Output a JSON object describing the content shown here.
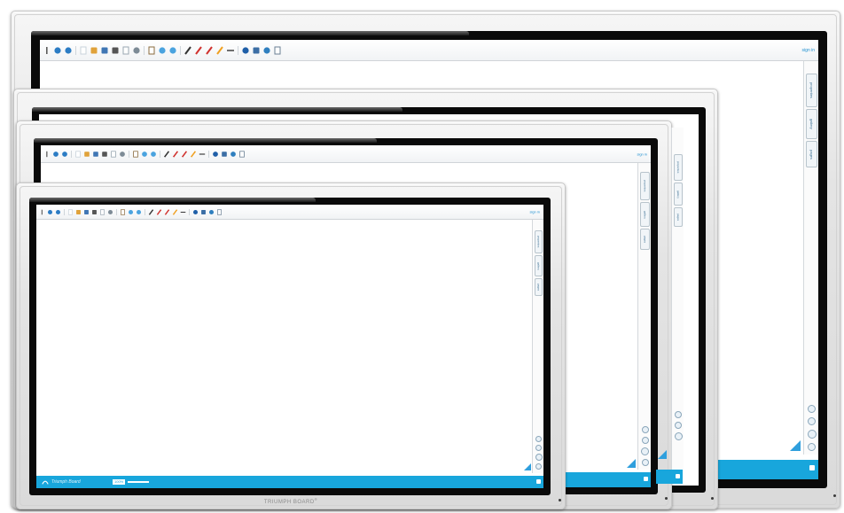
{
  "boards": [
    {
      "name": "board-xl",
      "signin": "sign in",
      "side_tabs": [
        "properties",
        "gallery",
        "pages"
      ]
    },
    {
      "name": "board-lg",
      "signin": "sign in",
      "side_tabs": [
        "properties",
        "gallery",
        "pages"
      ]
    },
    {
      "name": "board-md",
      "signin": "sign in",
      "side_tabs": [
        "properties",
        "gallery",
        "pages"
      ]
    },
    {
      "name": "board-sm",
      "signin": "sign in",
      "side_tabs": [
        "properties",
        "gallery",
        "pages"
      ]
    }
  ],
  "toolbar_icons": [
    "menu-icon",
    "undo-icon",
    "redo-icon",
    "new-page-icon",
    "open-folder-icon",
    "save-icon",
    "print-icon",
    "screen-shade-icon",
    "magnifier-icon",
    "clipboard-icon",
    "previous-page-icon",
    "next-page-icon",
    "pen-icon",
    "red-pen-icon",
    "highlighter-icon",
    "marker-icon",
    "line-icon",
    "eraser-icon",
    "text-icon",
    "globe-icon",
    "presenter-icon"
  ],
  "front_status": {
    "logo": "Triumph Board",
    "zoom": "100%"
  },
  "brand": "TRIUMPH BOARD",
  "brand_mark": "®",
  "colors": {
    "accent": "#18a6dc",
    "frame": "#0a0a0a",
    "bezel": "#e2e2e2",
    "link": "#1e8fd0"
  }
}
